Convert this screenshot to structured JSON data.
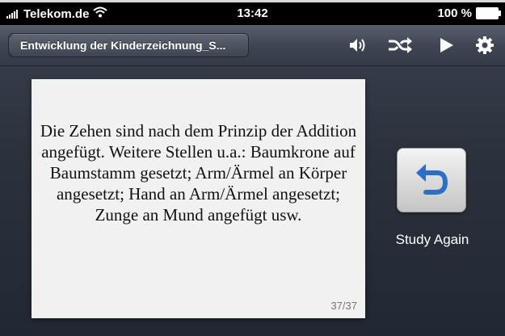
{
  "status_bar": {
    "carrier": "Telekom.de",
    "time": "13:42",
    "battery": "100 %"
  },
  "nav": {
    "back_title": "Entwicklung der Kinderzeichnung_S...",
    "icons": [
      "speaker-icon",
      "shuffle-icon",
      "play-icon",
      "gear-icon"
    ]
  },
  "card": {
    "text": "Die Zehen sind nach dem Prinzip der Addition angefügt. Weitere Stellen u.a.: Baumkrone auf Baumstamm gesetzt; Arm/Ärmel an Körper angesetzt; Hand an Arm/Ärmel angesetzt; Zunge an Mund angefügt usw.",
    "counter": "37/37"
  },
  "study_again": {
    "label": "Study Again",
    "accent": "#2d6fc4"
  }
}
